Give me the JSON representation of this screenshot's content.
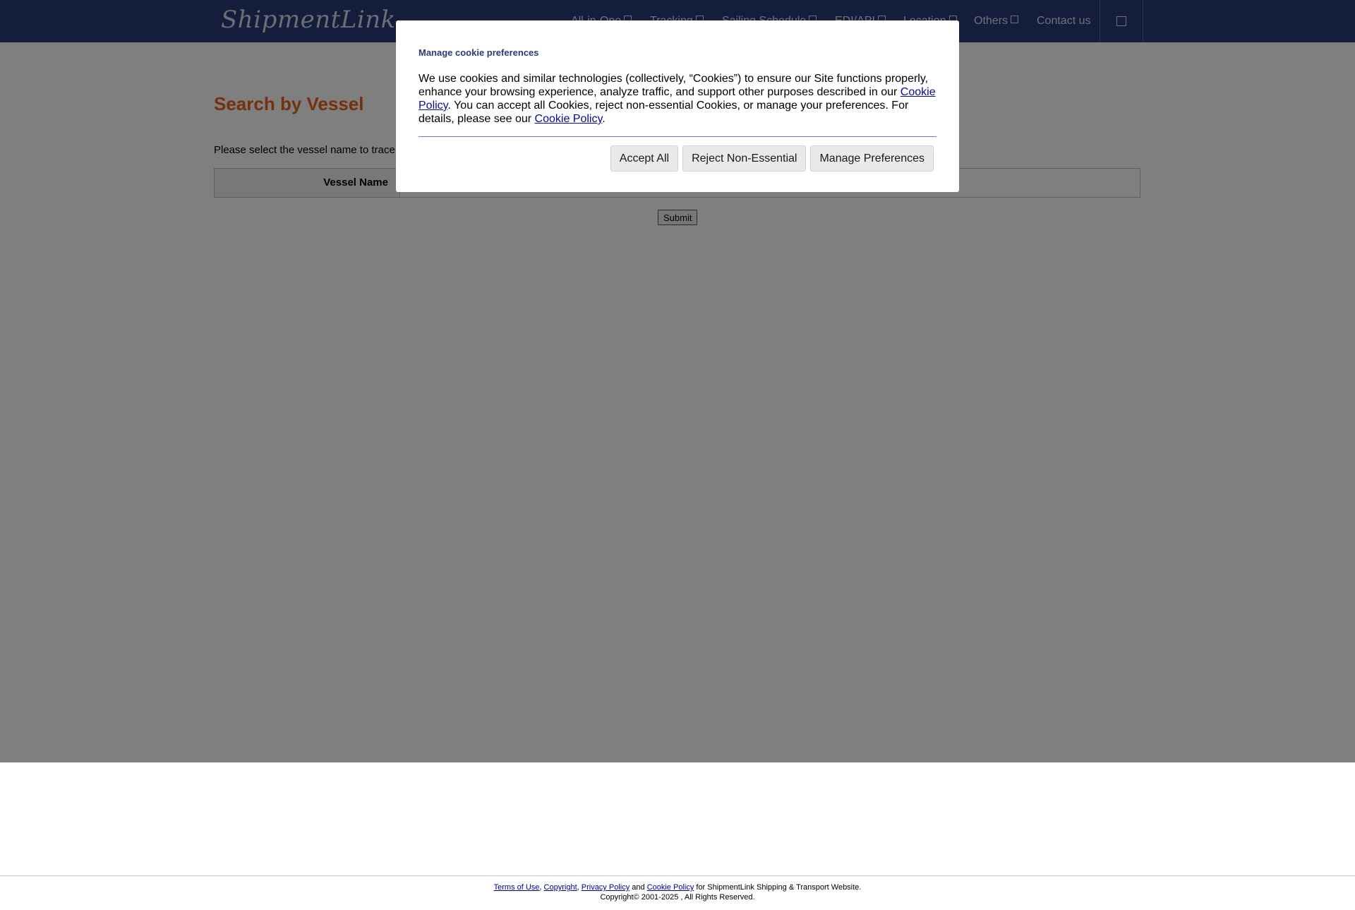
{
  "header": {
    "logo_text": "ShipmentLink",
    "nav": [
      {
        "label": "All-in-One"
      },
      {
        "label": "Tracking"
      },
      {
        "label": "Sailing Schedule"
      },
      {
        "label": "EDI/API"
      },
      {
        "label": "Location"
      },
      {
        "label": "Others"
      },
      {
        "label": "Contact us"
      }
    ]
  },
  "main": {
    "title": "Search by Vessel",
    "instruction": "Please select the vessel name to trace",
    "vessel_label": "Vessel Name",
    "submit_label": "Submit"
  },
  "footer": {
    "links": {
      "terms": "Terms of Use",
      "copyright": "Copyright",
      "privacy": "Privacy Policy",
      "cookie": "Cookie Policy"
    },
    "sep_comma": ", ",
    "and_text": " and ",
    "suffix": " for ShipmentLink Shipping & Transport Website.",
    "copyright_line": "Copyright© 2001-2025 , All Rights Reserved."
  },
  "cookie_modal": {
    "title": "Manage cookie preferences",
    "body_part1": "We use cookies and similar technologies (collectively, “Cookies”) to ensure our Site functions properly, enhance your browsing experience, analyze traffic, and support other purposes described in our ",
    "link1": "Cookie Policy",
    "body_part2": ". You can accept all Cookies, reject non-essential Cookies, or manage your preferences. For details, please see our ",
    "link2": "Cookie Policy",
    "body_part3": ".",
    "buttons": {
      "accept": "Accept All",
      "reject": "Reject Non-Essential",
      "manage": "Manage Preferences"
    }
  },
  "colors": {
    "nav_bg": "#2b3a78",
    "title_accent": "#e8631a",
    "overlay": "rgba(0,0,0,0.5)"
  }
}
